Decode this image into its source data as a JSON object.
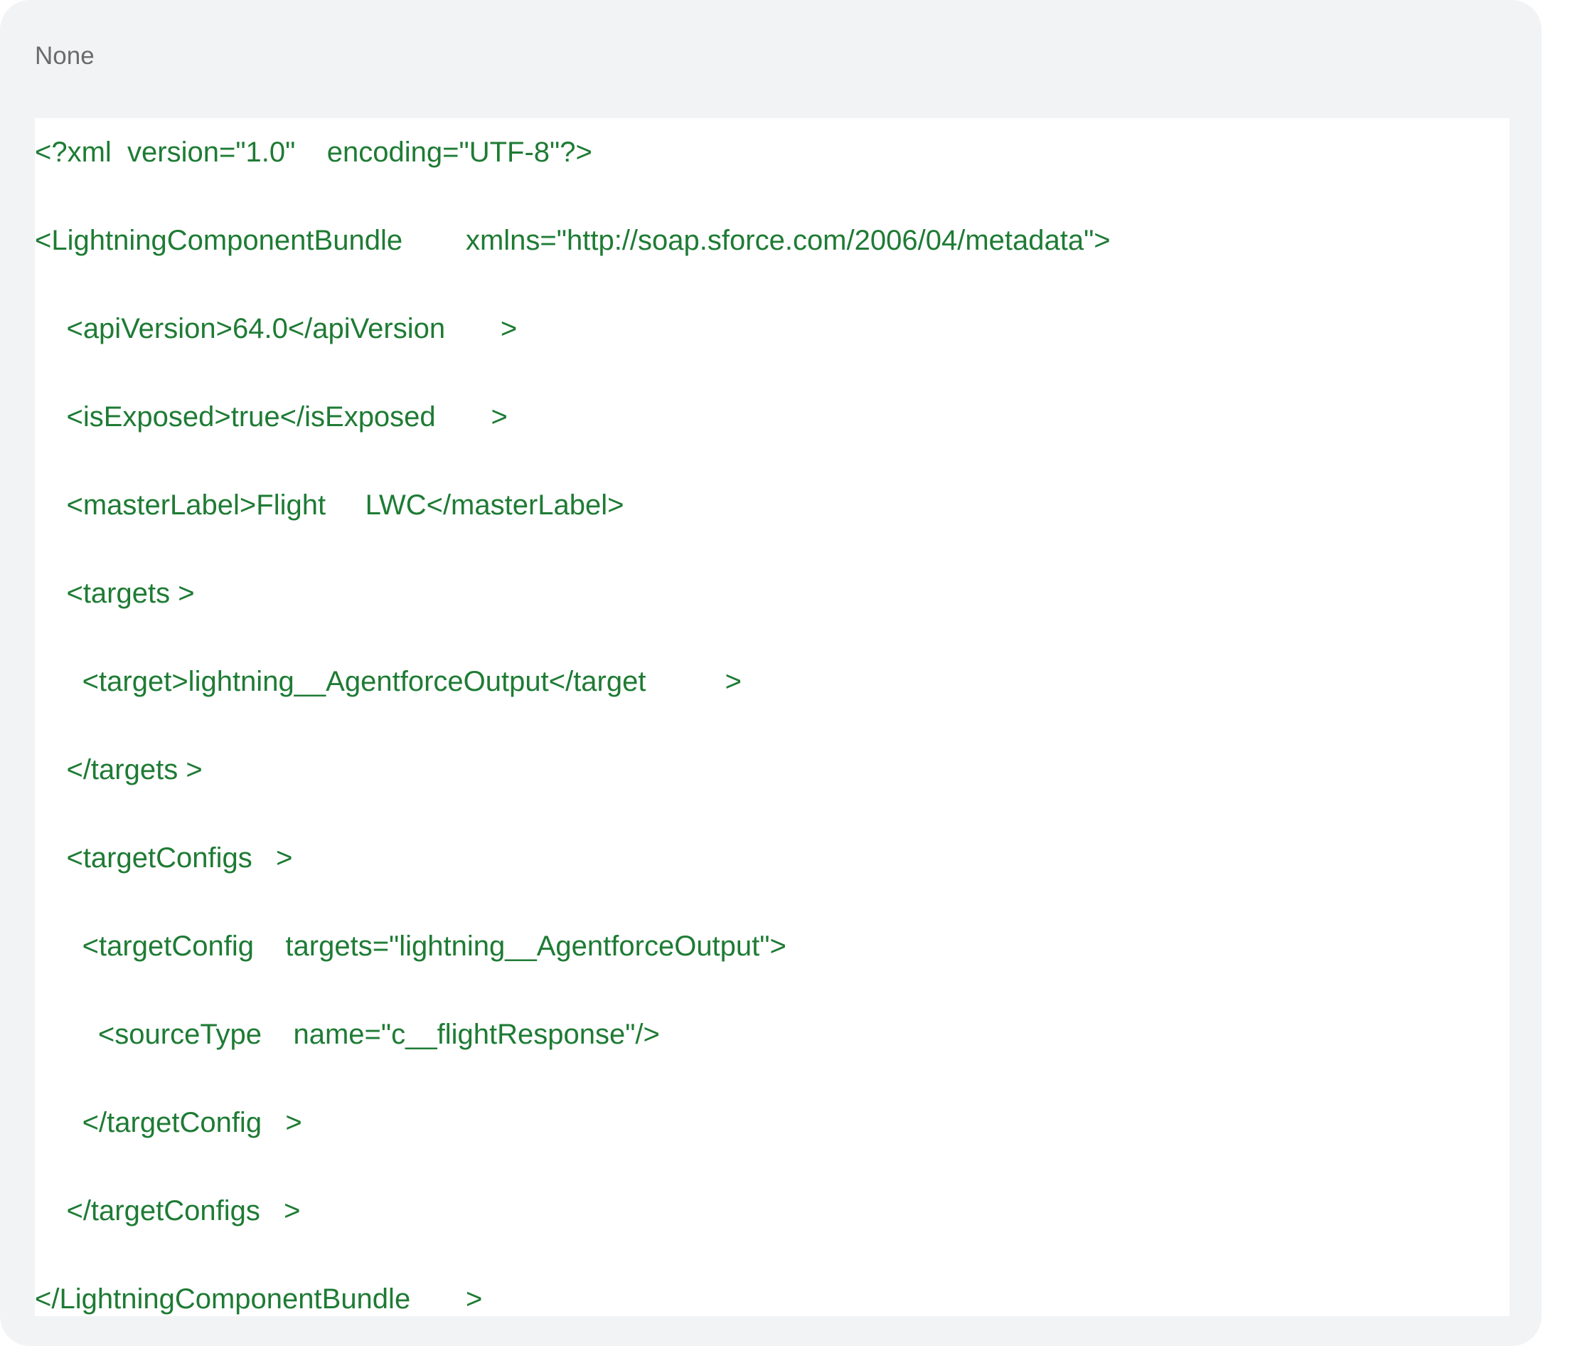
{
  "code_block": {
    "language": "None",
    "lines": [
      "<?xml  version=\"1.0\"    encoding=\"UTF-8\"?>",
      "<LightningComponentBundle        xmlns=\"http://soap.sforce.com/2006/04/metadata\">",
      "    <apiVersion>64.0</apiVersion       >",
      "    <isExposed>true</isExposed       >",
      "    <masterLabel>Flight     LWC</masterLabel>",
      "    <targets >",
      "      <target>lightning__AgentforceOutput</target          >",
      "    </targets >",
      "    <targetConfigs   >",
      "      <targetConfig    targets=\"lightning__AgentforceOutput\">",
      "        <sourceType    name=\"c__flightResponse\"/>",
      "      </targetConfig   >",
      "    </targetConfigs   >",
      "</LightningComponentBundle       >"
    ]
  },
  "colors": {
    "code_text": "#1e7b34",
    "label_text": "#6b6b6b",
    "panel_bg": "#f2f3f5"
  }
}
